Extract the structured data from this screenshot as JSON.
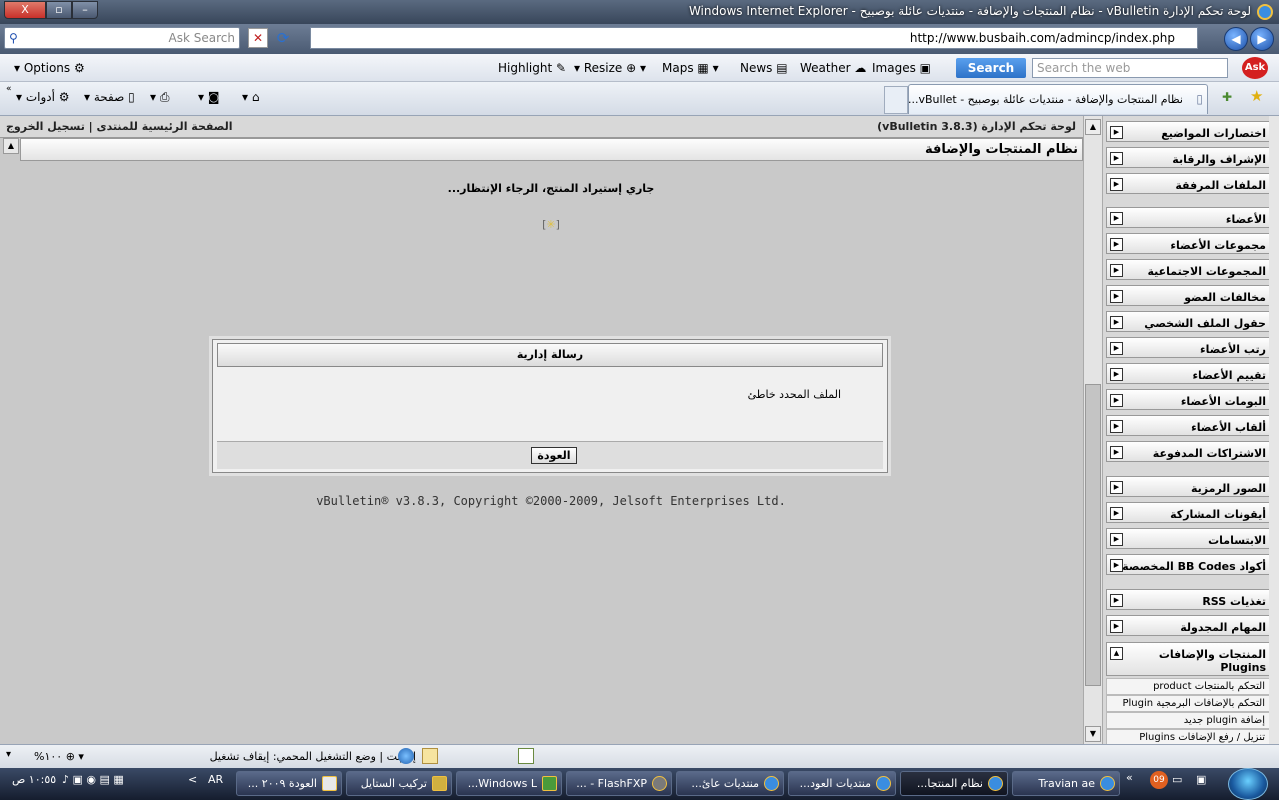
{
  "window": {
    "title": "Windows Internet Explorer - نظام المنتجات والإضافة - منتديات عائلة بوصبيح - vBulletin لوحة تحكم الإدارة"
  },
  "address": {
    "url": "http://www.busbaih.com/admincp/index.php",
    "search_placeholder": "Ask Search"
  },
  "links_toolbar": {
    "options": "Options",
    "highlight": "Highlight",
    "resize": "Resize",
    "maps": "Maps",
    "news": "News",
    "weather": "Weather",
    "images": "Images",
    "search_btn": "Search",
    "web_placeholder": "Search the web",
    "ask": "Ask"
  },
  "command_bar": {
    "tools": "أدوات",
    "page": "صفحة",
    "tab_title": "نظام المنتجات والإضافة - منتديات عائلة بوصبيح - vBullet..."
  },
  "content": {
    "breadcrumb": "لوحة تحكم الإدارة (vBulletin 3.8.3)",
    "top_links": "الصفحة الرئيسية للمنتدى | تسجيل الخروج",
    "header": "نظام المنتجات والإضافة",
    "loading": "جاري إستيراد المنتج، الرجاء الإنتظار...",
    "message_title": "رسالة إدارية",
    "message_body": "الملف المحدد خاطئ",
    "back_button": "العودة",
    "copyright": "vBulletin® v3.8.3, Copyright ©2000-2009, Jelsoft Enterprises Ltd."
  },
  "sidebar": {
    "groups": [
      {
        "label": "اختصارات المواضيع"
      },
      {
        "label": "الإشراف والرقابة"
      },
      {
        "label": "الملفات المرفقة"
      },
      {
        "label": "الأعضاء"
      },
      {
        "label": "مجموعات الأعضاء"
      },
      {
        "label": "المجموعات الاجتماعية"
      },
      {
        "label": "مخالفات العضو"
      },
      {
        "label": "حقول الملف الشخصي"
      },
      {
        "label": "رتب الأعضاء"
      },
      {
        "label": "تقييم الأعضاء"
      },
      {
        "label": "البومات الأعضاء"
      },
      {
        "label": "ألقاب الأعضاء"
      },
      {
        "label": "الاشتراكات المدفوعة"
      },
      {
        "label": "الصور الرمزية"
      },
      {
        "label": "أيقونات المشاركة"
      },
      {
        "label": "الابتسامات"
      },
      {
        "label": "أكواد BB Codes المخصصة"
      },
      {
        "label": "تغذيات RSS"
      },
      {
        "label": "المهام المجدولة"
      },
      {
        "label": "المنتجات والإضافات Plugins"
      }
    ],
    "subitems": [
      {
        "label": "التحكم بالمنتجات product"
      },
      {
        "label": "التحكم بالإضافات البرمجية Plugin"
      },
      {
        "label": "إضافة plugin جديد"
      },
      {
        "label": "تنزيل / رفع الإضافات Plugins"
      }
    ]
  },
  "status": {
    "text": "إنترنت | وضع التشغيل المحمي: إيقاف تشغيل",
    "zoom": "%١٠٠"
  },
  "taskbar": {
    "items": [
      {
        "label": "Travian ae"
      },
      {
        "label": "نظام المنتجا..."
      },
      {
        "label": "منتديات العود..."
      },
      {
        "label": "منتديات عائ..."
      },
      {
        "label": "FlashFXP - ..."
      },
      {
        "label": "Windows L..."
      },
      {
        "label": "تركيب الستايل"
      },
      {
        "label": "العودة ٢٠٠٩ ..."
      }
    ],
    "lang": "AR",
    "clock": "١٠:٥٥ ص",
    "badge": "09"
  }
}
